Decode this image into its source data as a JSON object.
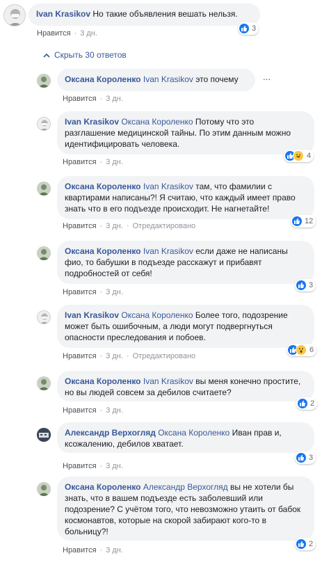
{
  "root_comment": {
    "author": "Ivan Krasikov",
    "text": "Но такие объявления вешать нельзя.",
    "like_label": "Нравится",
    "time": "3 дн.",
    "reaction_count": "3",
    "reaction_types": [
      "like-icon"
    ]
  },
  "hide_replies": "Скрыть 30 ответов",
  "replies": [
    {
      "author": "Оксана Короленко",
      "mention": "Ivan Krasikov",
      "text": " это почему",
      "like_label": "Нравится",
      "time": "3 дн."
    },
    {
      "author": "Ivan Krasikov",
      "mention": "Оксана Короленко",
      "text": " Потому что это разглашение медицинской тайны. По этим данным можно идентифицировать человека.",
      "like_label": "Нравится",
      "time": "3 дн.",
      "reaction_count": "4",
      "reaction_types": [
        "like-icon",
        "laugh-icon"
      ]
    },
    {
      "author": "Оксана Короленко",
      "mention": "Ivan Krasikov",
      "text": " там, что фамилии с квартирами написаны?! Я считаю, что каждый имеет право знать что в его подъезде происходит. Не нагнетайте!",
      "like_label": "Нравится",
      "time": "3 дн.",
      "edited_label": "Отредактировано",
      "reaction_count": "12",
      "reaction_types": [
        "like-icon"
      ]
    },
    {
      "author": "Оксана Короленко",
      "mention": "Ivan Krasikov",
      "text": " если даже не написаны фио, то бабушки в подъезде расскажут и прибавят подробностей от себя!",
      "like_label": "Нравится",
      "time": "3 дн.",
      "reaction_count": "3",
      "reaction_types": [
        "like-icon"
      ]
    },
    {
      "author": "Ivan Krasikov",
      "mention": "Оксана Короленко",
      "text": " Более того, подозрение может быть ошибочным, а люди могут подвергнуться опасности преследования и побоев.",
      "like_label": "Нравится",
      "time": "3 дн.",
      "edited_label": "Отредактировано",
      "reaction_count": "6",
      "reaction_types": [
        "like-icon",
        "wow-icon"
      ]
    },
    {
      "author": "Оксана Короленко",
      "mention": "Ivan Krasikov",
      "text": " вы меня конечно простите, но вы людей совсем за дебилов считаете?",
      "like_label": "Нравится",
      "time": "3 дн.",
      "reaction_count": "2",
      "reaction_types": [
        "like-icon"
      ]
    },
    {
      "author": "Александр Верхогляд",
      "mention": "Оксана Короленко",
      "text": " Иван прав и, ксожалению, дебилов хватает.",
      "like_label": "Нравится",
      "time": "3 дн.",
      "reaction_count": "3",
      "reaction_types": [
        "like-icon"
      ]
    },
    {
      "author": "Оксана Короленко",
      "mention": "Александр Верхогляд",
      "text": " вы не хотели бы знать, что в вашем подъезде есть заболевший или подозрение? С учётом того, что невозможно утаить от бабок космонавтов, которые на скорой забирают кого-то в больницу?!",
      "like_label": "Нравится",
      "time": "3 дн.",
      "reaction_count": "2",
      "reaction_types": [
        "like-icon"
      ]
    }
  ],
  "colors": {
    "link": "#385898",
    "bubble": "#f2f3f5",
    "meta": "#90949c",
    "like": "#1877f2"
  }
}
